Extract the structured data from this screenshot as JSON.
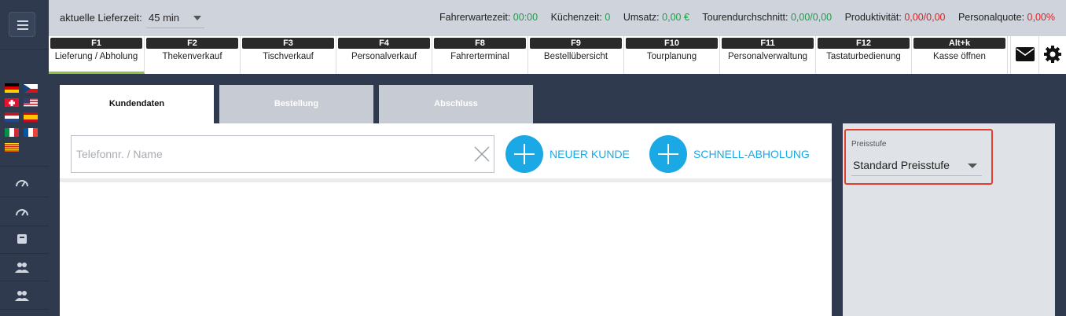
{
  "topbar": {
    "delivery_time_label": "aktuelle Lieferzeit:",
    "delivery_time_value": "45 min",
    "stats": [
      {
        "label": "Fahrerwartezeit:",
        "value": "00:00",
        "color": "#1e9e4a"
      },
      {
        "label": "Küchenzeit:",
        "value": "0",
        "color": "#1e9e4a"
      },
      {
        "label": "Umsatz:",
        "value": "0,00 €",
        "color": "#1e9e4a"
      },
      {
        "label": "Tourendurchschnitt:",
        "value": "0,00/0,00",
        "color": "#1e9e4a"
      },
      {
        "label": "Produktivität:",
        "value": "0,00/0,00",
        "color": "#e02020"
      },
      {
        "label": "Personalquote:",
        "value": "0,00%",
        "color": "#e02020"
      }
    ]
  },
  "fkeys": [
    {
      "key": "F1",
      "label": "Lieferung / Abholung",
      "active": true
    },
    {
      "key": "F2",
      "label": "Thekenverkauf"
    },
    {
      "key": "F3",
      "label": "Tischverkauf"
    },
    {
      "key": "F4",
      "label": "Personalverkauf"
    },
    {
      "key": "F8",
      "label": "Fahrerterminal"
    },
    {
      "key": "F9",
      "label": "Bestellübersicht"
    },
    {
      "key": "F10",
      "label": "Tourplanung"
    },
    {
      "key": "F11",
      "label": "Personalverwaltung"
    },
    {
      "key": "F12",
      "label": "Tastaturbedienung"
    },
    {
      "key": "Alt+k",
      "label": "Kasse öffnen"
    }
  ],
  "header_icons": [
    "mail-icon",
    "gear-icon"
  ],
  "tabs": [
    {
      "label": "Kundendaten",
      "active": true
    },
    {
      "label": "Bestellung"
    },
    {
      "label": "Abschluss"
    }
  ],
  "search": {
    "placeholder": "Telefonnr. / Name",
    "value": ""
  },
  "buttons": {
    "new_customer": "NEUER KUNDE",
    "quick_pickup": "SCHNELL-ABHOLUNG"
  },
  "price_level": {
    "label": "Preisstufe",
    "value": "Standard Preisstufe"
  },
  "sidebar": {
    "flags": [
      "de",
      "cz",
      "ch",
      "us",
      "nl",
      "es",
      "it",
      "fr",
      "catalonia"
    ],
    "icons": [
      "speedometer-icon",
      "speedometer-icon",
      "box-icon",
      "users-icon",
      "users-icon"
    ]
  },
  "colors": {
    "accent": "#1ba9e6",
    "sidebar_bg": "#2f3a4f",
    "highlight_border": "#e23d2f",
    "active_tab_underline": "#8bc34a"
  }
}
